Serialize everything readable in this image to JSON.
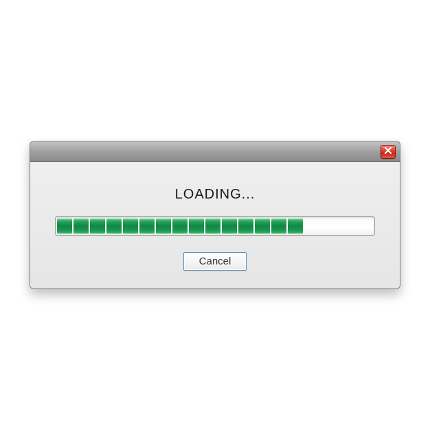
{
  "dialog": {
    "title": "LOADING...",
    "cancel_label": "Cancel"
  },
  "progress": {
    "filled_segments": 15,
    "total_segments": 20
  },
  "colors": {
    "progress_fill": "#1C9850",
    "close_button": "#E84030"
  }
}
